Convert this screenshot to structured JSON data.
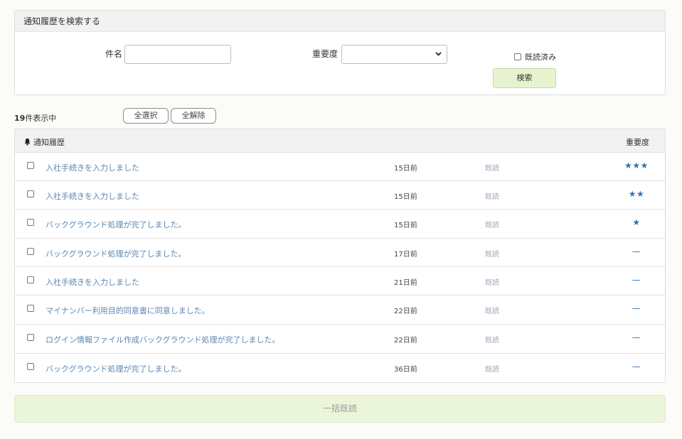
{
  "search": {
    "title": "通知履歴を検索する",
    "subject_label": "件名",
    "subject_value": "",
    "priority_label": "重要度",
    "priority_selected": "",
    "read_filter_label": "既読済み",
    "read_filter_checked": false,
    "submit_label": "検索"
  },
  "toolbar": {
    "count_number": "19",
    "count_suffix": "件表示中",
    "select_all_label": "全選択",
    "deselect_all_label": "全解除"
  },
  "table": {
    "header_title": "通知履歴",
    "header_priority": "重要度",
    "rows": [
      {
        "title": "入社手続きを入力しました",
        "age": "15日前",
        "status": "既読",
        "priority": "★★★"
      },
      {
        "title": "入社手続きを入力しました",
        "age": "15日前",
        "status": "既読",
        "priority": "★★"
      },
      {
        "title": "バックグラウンド処理が完了しました。",
        "age": "15日前",
        "status": "既読",
        "priority": "★"
      },
      {
        "title": "バックグラウンド処理が完了しました。",
        "age": "17日前",
        "status": "既読",
        "priority": "—"
      },
      {
        "title": "入社手続きを入力しました",
        "age": "21日前",
        "status": "既読",
        "priority": "—"
      },
      {
        "title": "マイナンバー利用目的同意書に同意しました。",
        "age": "22日前",
        "status": "既読",
        "priority": "—"
      },
      {
        "title": "ログイン情報ファイル作成バックグラウンド処理が完了しました。",
        "age": "22日前",
        "status": "既読",
        "priority": "—"
      },
      {
        "title": "バックグラウンド処理が完了しました。",
        "age": "36日前",
        "status": "既読",
        "priority": "—"
      }
    ]
  },
  "bulk_read_label": "一括既読",
  "icons": {
    "header": "bell-icon",
    "select": "chevron-down-icon"
  },
  "colors": {
    "link": "#5b86b0",
    "priority_star": "#3472b3",
    "accent_button": "#e7f3cf",
    "bulk_button": "#ebf5d9"
  }
}
